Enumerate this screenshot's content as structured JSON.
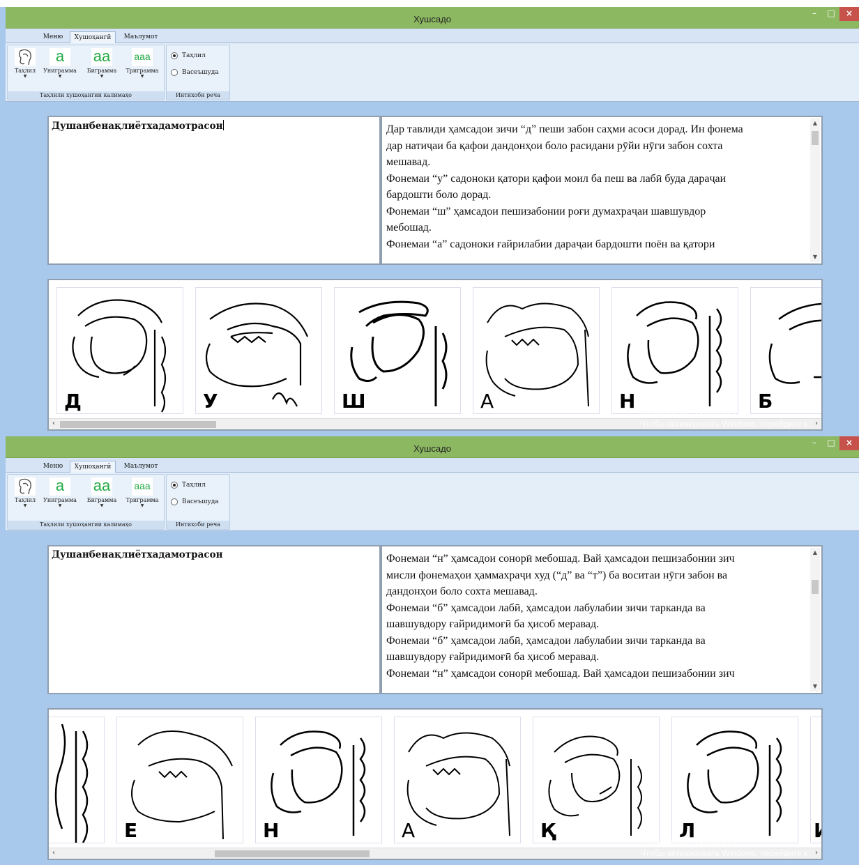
{
  "windows": [
    {
      "title": "Хушсадо",
      "menu": [
        "Меню",
        "Хушоҳангӣ",
        "Маълумот"
      ],
      "active_tab": 1,
      "ribbon": {
        "buttons": [
          {
            "label": "Таҳлил",
            "icon": "head-profile-icon",
            "glyph": ""
          },
          {
            "label": "Униграмма",
            "icon": "unigram-icon",
            "glyph": "a"
          },
          {
            "label": "Биграмма",
            "icon": "bigram-icon",
            "glyph": "aa"
          },
          {
            "label": "Триграмма",
            "icon": "trigram-icon",
            "glyph": "aaa"
          }
        ],
        "group1_label": "Таҳлили хушоҳангии калимаҳо",
        "radios": [
          {
            "label": "Таҳлил",
            "checked": true
          },
          {
            "label": "Васеъшуда",
            "checked": false
          }
        ],
        "group2_label": "Интихоби реча"
      },
      "input_word": "Душанбенақлиётхадамотрасон",
      "description_lines": [
        "Дар тавлиди ҳамсадои зичи “д” пеши забон саҳми асоси дорад. Ин фонема",
        "дар натиҷаи ба қафои дандонҳои боло расидани рӯйи нӯги забон сохта",
        "мешавад.",
        "Фонемаи “у” садоноки қатори қафои моил ба пеш ва лабӣ буда дараҷаи",
        "бардошти боло дорад.",
        "Фонемаи “ш” ҳамсадои пешизабонии роғи думахраҷаи шавшувдор",
        "мебошад.",
        "Фонемаи “а” садоноки ғайрилабии дараҷаи бардошти поён ва қатори"
      ],
      "cards": [
        "Д",
        "У",
        "Ш",
        "А",
        "Н",
        "Б"
      ],
      "watermark": [
        "Активация Windows",
        "Чтобы активировать Windows, перейдите к"
      ]
    },
    {
      "title": "Хушсадо",
      "menu": [
        "Меню",
        "Хушоҳангӣ",
        "Маълумот"
      ],
      "active_tab": 1,
      "ribbon": {
        "buttons": [
          {
            "label": "Таҳлил",
            "icon": "head-profile-icon",
            "glyph": ""
          },
          {
            "label": "Униграмма",
            "icon": "unigram-icon",
            "glyph": "a"
          },
          {
            "label": "Биграмма",
            "icon": "bigram-icon",
            "glyph": "aa"
          },
          {
            "label": "Триграмма",
            "icon": "trigram-icon",
            "glyph": "aaa"
          }
        ],
        "group1_label": "Таҳлили хушоҳангии калимаҳо",
        "radios": [
          {
            "label": "Таҳлил",
            "checked": true
          },
          {
            "label": "Васеъшуда",
            "checked": false
          }
        ],
        "group2_label": "Интихоби реча"
      },
      "input_word": "Душанбенақлиётхадамотрасон",
      "description_lines": [
        "Фонемаи “н” ҳамсадои сонорӣ мебошад. Вай ҳамсадои пешизабонии зич",
        "мисли фонемаҳои ҳаммахраҷи худ (“д” ва “т”) ба воситаи нӯги забон ва",
        "дандонҳои боло сохта мешавад.",
        "Фонемаи “б” ҳамсадои лабӣ, ҳамсадои лабулабии зичи тарканда ва",
        "шавшувдору ғайридимоғӣ ба ҳисоб меравад.",
        "Фонемаи “б” ҳамсадои лабӣ, ҳамсадои лабулабии зичи тарканда ва",
        "шавшувдору ғайридимоғӣ ба ҳисоб меравад.",
        "Фонемаи “н” ҳамсадои сонорӣ мебошад. Вай ҳамсадои пешизабонии зич"
      ],
      "cards": [
        "",
        "Е",
        "Н",
        "А",
        "Қ",
        "Л",
        "И"
      ],
      "watermark": [
        "Активация Windows",
        "Чтобы активировать Windows, перейдите к"
      ]
    }
  ]
}
